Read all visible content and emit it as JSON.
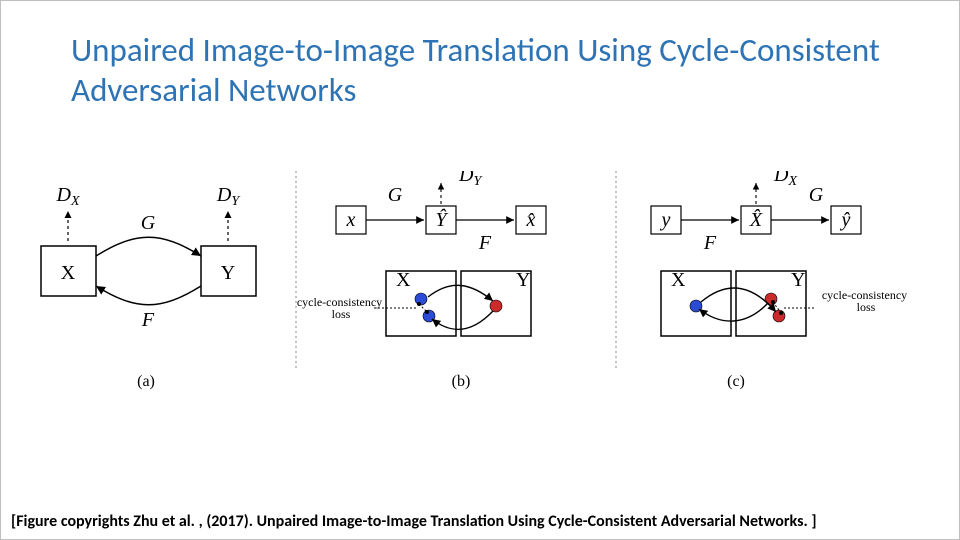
{
  "title": "Unpaired Image-to-Image Translation Using Cycle-Consistent Adversarial Networks",
  "caption": "[Figure copyrights Zhu et al. , (2017).  Unpaired Image-to-Image Translation Using Cycle-Consistent Adversarial Networks. ]",
  "fig": {
    "panel_a": {
      "X": "X",
      "Y": "Y",
      "G": "G",
      "F": "F",
      "DX": "D",
      "DXsub": "X",
      "DY": "D",
      "DYsub": "Y",
      "label": "(a)"
    },
    "panel_b": {
      "x": "x",
      "Yhat": "Ŷ",
      "xhat": "x̂",
      "G": "G",
      "F": "F",
      "DY": "D",
      "DYsub": "Y",
      "X": "X",
      "Y": "Y",
      "cc1": "cycle-consistency",
      "cc2": "loss",
      "label": "(b)"
    },
    "panel_c": {
      "y": "y",
      "Xhat": "X̂",
      "yhat": "ŷ",
      "G": "G",
      "F": "F",
      "DX": "D",
      "DXsub": "X",
      "X": "X",
      "Y": "Y",
      "cc1": "cycle-consistency",
      "cc2": "loss",
      "label": "(c)"
    }
  }
}
